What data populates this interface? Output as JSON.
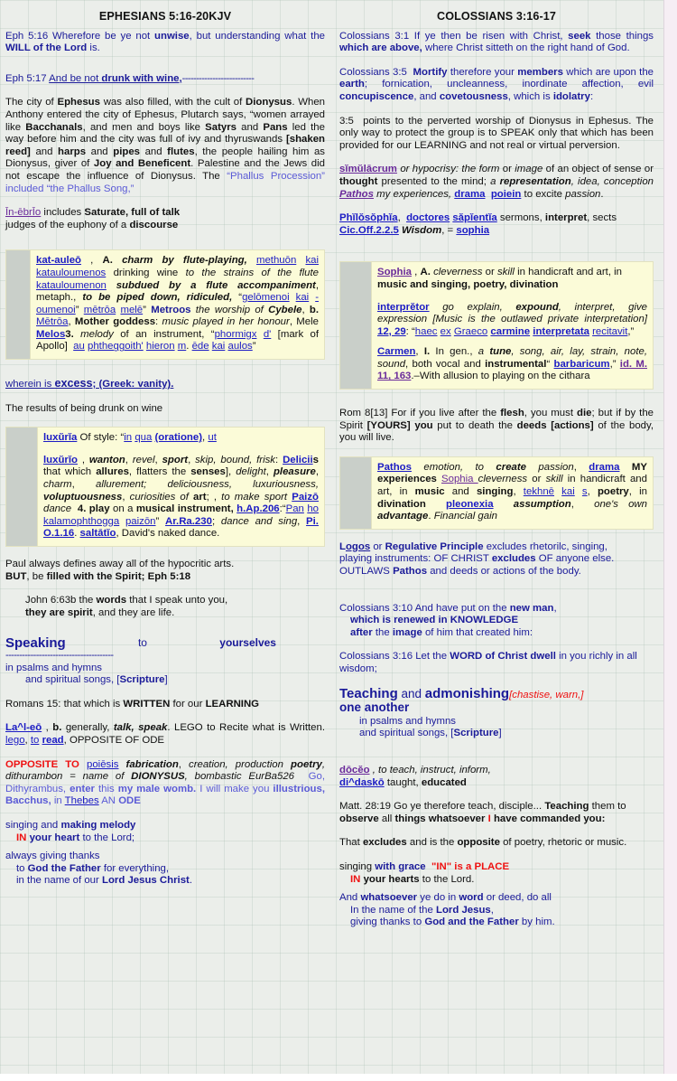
{
  "page": {
    "background_color": "#ebeeea",
    "grid_color": "#b0c4b8",
    "right_margin_color": "#f6eef4",
    "highlight_color": "#fbfbd8",
    "gutter_color": "#c9cfc9",
    "text_blue": "#1a1a99",
    "text_red": "#ee1111",
    "link_blue": "#1b1bc4",
    "link_purple": "#6a2a9a"
  },
  "left": {
    "title": "EPHESIANS 5:16-20KJV",
    "p1_a": "Eph 5:16 Wherefore be ye not ",
    "p1_b": "unwise",
    "p1_c": ", but understanding what the ",
    "p1_d": "WILL of the Lord",
    "p1_e": " is.",
    "p2_a": "Eph 5:17 ",
    "p2_b": "And be not ",
    "p2_c": "drunk with wine,",
    "p2_dash": "--------------------------",
    "p3": "The city of Ephesus was also filled, with the cult of Dionysus. When Anthony entered the city of Ephesus, Plutarch says, “women arrayed like Bacchanals, and men and boys like Satyrs and Pans led the way before him and the city was full of ivy and thyruswands [shaken reed] and harps and pipes and flutes, the people hailing him as Dionysus, giver of Joy and Beneficent. Palestine and the Jews did not escape the influence of Dionysus. The “Phallus Procession” included “the Phallus Song,”",
    "p4_a": "Īn-ēbrĪo",
    "p4_b": " includes ",
    "p4_c": "Saturate, full of talk",
    "p4_d": "judges of the euphony of a ",
    "p4_e": "discourse",
    "ybox1": "kat-auleō , A. charm by flute-playing, methuōn kai katauloumenos drinking wine to the strains of the flute katauloumenon subdued by a flute accompaniment, metaph., to be piped down, ridiculed, “gelōmenoi kai -oumenoi” mētrōa melē” Metroos the worship of Cybele, b. Mētrōa, Mother goddess: music played in her honour, Mele Melos3. melody of an instrument, “phormigx d’ [mark of Apollo] au phtheggoith’ hieron m. ēde kai aulos”",
    "p5_a": "wherein is ",
    "p5_b": "excess",
    "p5_c": ";  (Greek: vanity).",
    "p6": "The results of being drunk on wine",
    "ybox2_l1": "luxūrĪa Of style: “in qua (oratione), ut",
    "ybox2_l2": "luxūrĪo , wanton, revel, sport, skip, bound, frisk: Deliciis that which allures, flatters the senses], delight, pleasure, charm, allurement; deliciousness, luxuriousness, voluptuousness, curiosities of art; , to make sport Paizō dance  4. play on a musical instrument, h.Ap.206:“Pan ho kalamophthogga paizōn” Ar.Ra.230; dance and sing, Pi. O.1.16. saltātĪo, David's naked dance.",
    "p7_a": "Paul always defines away all of the hypocritic arts.",
    "p7_b": "BUT",
    "p7_c": ", be ",
    "p7_d": "filled with the Spirit; Eph 5:18",
    "p8_a": "John 6:63b the ",
    "p8_b": "words",
    "p8_c": " that I speak unto you,",
    "p8_d": "they are spirit",
    "p8_e": ", and they are life.",
    "speaking": "Speaking",
    "to": "to",
    "yourselves": "yourselves",
    "speaking_dashes": "---------------------------------------",
    "p9_a": "in psalms and hymns",
    "p9_b": "and spiritual songs, [",
    "p9_c": "Scripture",
    "p9_d": "]",
    "p10_a": "Romans 15: that which is ",
    "p10_b": "WRITTEN",
    "p10_c": " for our ",
    "p10_d": "LEARNING",
    "p11": "La^l-eō , b. generally, talk, speak. LEGO to Recite what is Written. lego, to read,  OPPOSITE OF ODE",
    "p12": "OPPOSITE TO poiēsis fabrication, creation, production poetry, dithurambon = name of DIONYSUS, bombastic EurBa526  Go, Dithyrambus, enter this my male womb.  I will make you illustrious, Bacchus, in Thebes AN ODE",
    "p13_a": "singing and ",
    "p13_b": "making melody",
    "p13_c": "IN",
    "p13_d": " your heart",
    "p13_e": " to the Lord;",
    "p14_a": "always giving thanks",
    "p14_b": "to ",
    "p14_c": "God the Father",
    "p14_d": " for everything,",
    "p14_e": "in the name of our ",
    "p14_f": "Lord Jesus Christ",
    "p14_g": "."
  },
  "right": {
    "title": "COLOSSIANS 3:16-17",
    "p1": "Colossians 3:1 If ye then be risen with Christ, seek those things which are above, where Christ sitteth on the right hand of God.",
    "p2": "Colossians 3:5  Mortify therefore your members which are upon the earth; fornication, uncleanness, inordinate affection, evil concupiscence, and covetousness, which is idolatry:",
    "p3": "3:5  points to the perverted worship of Dionysus in Ephesus. The only way to protect the group is to SPEAK only that which has been provided for our LEARNING and not real or virtual perversion.",
    "p4": "sĪmūlācrum or hypocrisy: the form or image of an object of sense or thought presented to the mind; a representation, idea, conception Pathos my experiences, drama  poiein to excite passion.",
    "p5": "PhĪlōsōphĪa,  doctores săpĪentĪa sermons, interpret, sects Cic.Off.2.2.5 Wisdom, = sophia",
    "ybox1_l1": "Sophia , A. cleverness or skill in handicraft and art, in music and singing, poetry, divination",
    "ybox1_l2": "interprĕtor  go explain,  expound,  interpret,  give expression [Music is the outlawed private interpretation] 12, 29: “haec ex Graeco carmine interpretata recitavit,”",
    "ybox1_l3": "Carmen, I. In gen., a tune, song, air, lay, strain, note, sound, both vocal and instrumental“ barbaricum,” id. M. 11, 163.–With allusion to playing on the cithara",
    "p6": "Rom 8[13] For if you live after the flesh, you must die; but if by the Spirit [YOURS] you put to death the deeds [actions] of the body, you will live.",
    "ybox2": "Pathos emotion, to create passion, drama MY experiences Sophia cleverness or skill in handicraft and art, in music and singing, tekhnē kai s, poetry, in divination pleonexia assumption, one's own advantage. Financial gain",
    "p7": "Logos or Regulative Principle excludes rhetorilc, singing, playing instruments: OF CHRIST excludes OF anyone else. OUTLAWS Pathos and deeds or actions of the body.",
    "p8_a": "Colossians 3:10 And have put on the ",
    "p8_b": "new man",
    "p8_c": ",",
    "p8_d": "which is renewed in KNOWLEDGE",
    "p8_e": "after",
    "p8_f": " the ",
    "p8_g": "image",
    "p8_h": " of him that created him:",
    "p9_a": "Colossians 3:16 Let the ",
    "p9_b": "WORD of Christ dwell",
    "p9_c": " in you richly in all wisdom;",
    "p10_a": "Teaching",
    "p10_b": " and ",
    "p10_c": "admonishing",
    "p10_d": "[chastise, warn,]",
    "p10_e": "one another",
    "p10_f": "in psalms and hymns",
    "p10_g": "and spiritual songs, [",
    "p10_h": "Scripture",
    "p10_i": "]",
    "p11_a": "dōcĕo",
    "p11_b": " , to teach, instruct, inform,",
    "p11_c": "di^daskō",
    "p11_d": " taught, educated",
    "p12_a": "Matt. 28:19 Go ye therefore teach, disciple... ",
    "p12_b": "Teaching",
    "p12_c": " them to ",
    "p12_d": "observe",
    "p12_e": " all ",
    "p12_f": "things whatsoever ",
    "p12_g": "I",
    "p12_h": " have commanded you:",
    "p13_a": "That ",
    "p13_b": "excludes",
    "p13_c": " and is the ",
    "p13_d": "opposite",
    "p13_e": " of poetry, rhetoric or music.",
    "p14_a": "singing ",
    "p14_b": "with grace",
    "p14_c": "\"IN\" is a PLACE",
    "p14_d": "IN",
    "p14_e": " your hearts",
    "p14_f": " to the Lord.",
    "p15_a": "And ",
    "p15_b": "whatsoever",
    "p15_c": " ye do in ",
    "p15_d": "word",
    "p15_e": " or deed, do all",
    "p15_f": "In the name of the ",
    "p15_g": "Lord Jesus",
    "p15_h": ",",
    "p15_i": "giving thanks to ",
    "p15_j": "God and the Father",
    "p15_k": " by him."
  }
}
